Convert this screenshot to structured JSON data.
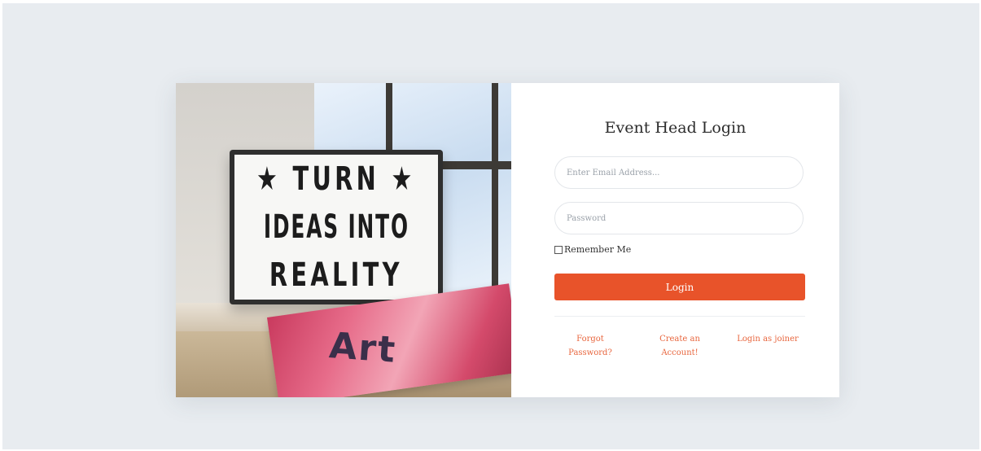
{
  "login": {
    "title": "Event Head Login",
    "email_placeholder": "Enter Email Address...",
    "password_placeholder": "Password",
    "remember_label": "Remember Me",
    "login_button_label": "Login",
    "links": {
      "forgot_line1": "Forgot",
      "forgot_line2": "Password?",
      "create_line1": "Create an",
      "create_line2": "Account!",
      "joiner": "Login as joiner"
    }
  },
  "photo": {
    "lightbox_lines": [
      "★ TURN ★",
      "IDEAS INTO",
      "REALITY"
    ],
    "magazine_text": "Art"
  },
  "colors": {
    "accent": "#e8532a",
    "link": "#e8663e",
    "background": "#e8ecf0"
  }
}
